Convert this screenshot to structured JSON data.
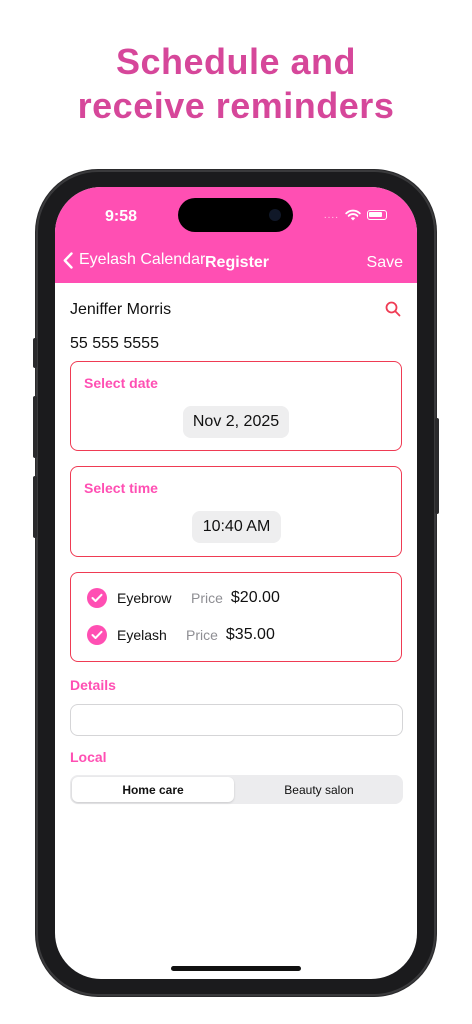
{
  "promo": {
    "line1": "Schedule and",
    "line2": "receive reminders"
  },
  "status_bar": {
    "time": "9:58",
    "signal": "....",
    "icons": [
      "wifi-icon",
      "battery-icon"
    ]
  },
  "navbar": {
    "back_label": "Eyelash Calendar",
    "title": "Register",
    "save_label": "Save"
  },
  "client": {
    "name": "Jeniffer Morris",
    "phone": "55 555 5555"
  },
  "date_section": {
    "label": "Select date",
    "value": "Nov 2, 2025"
  },
  "time_section": {
    "label": "Select time",
    "value": "10:40 AM"
  },
  "services": [
    {
      "name": "Eyebrow",
      "price_label": "Price",
      "price": "$20.00",
      "checked": true
    },
    {
      "name": "Eyelash",
      "price_label": "Price",
      "price": "$35.00",
      "checked": true
    }
  ],
  "details": {
    "label": "Details",
    "value": ""
  },
  "local": {
    "label": "Local",
    "options": [
      "Home care",
      "Beauty salon"
    ],
    "selected": "Home care"
  },
  "colors": {
    "accent": "#ff4fb3",
    "headline": "#d6479a",
    "border": "#ef3b54"
  }
}
